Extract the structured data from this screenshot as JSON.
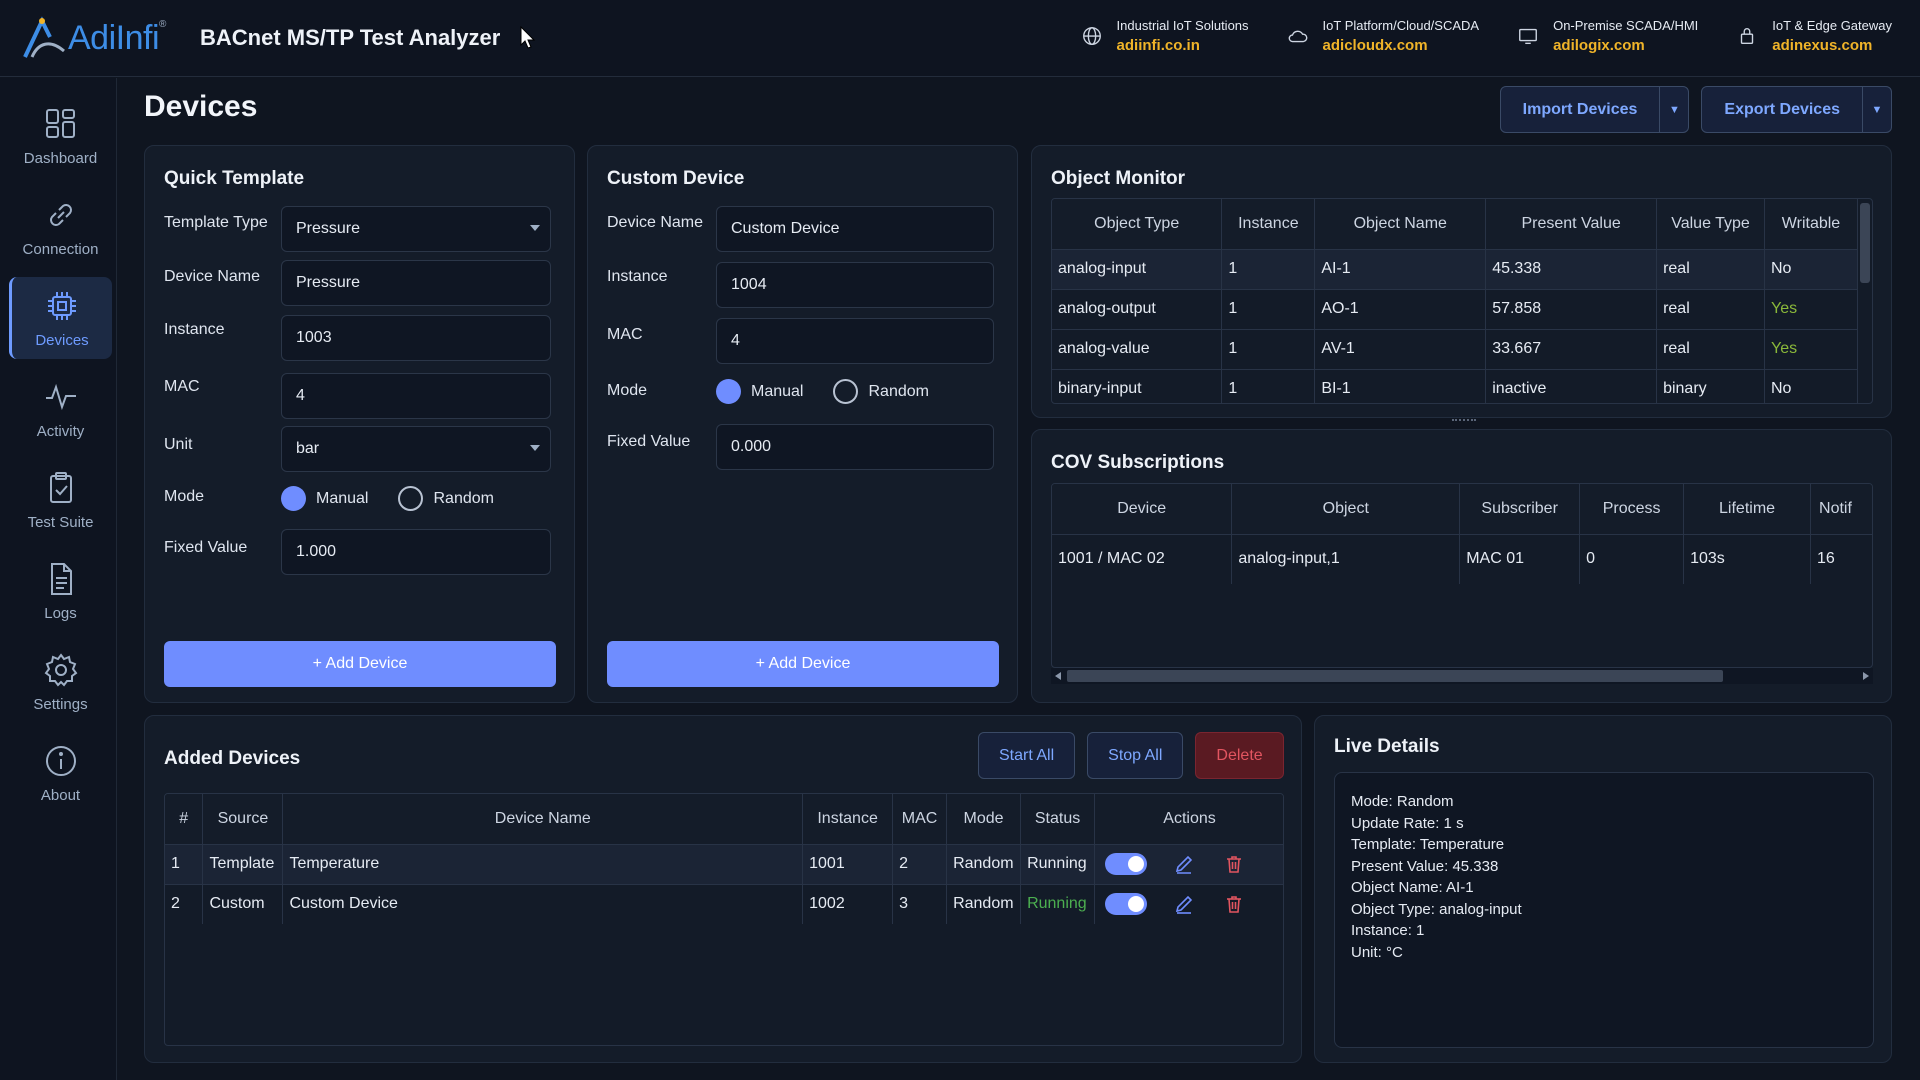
{
  "brand": {
    "logo_text": "AdiInfi",
    "logo_reg": "®",
    "app_title": "BACnet MS/TP Test Analyzer"
  },
  "links": [
    {
      "caption": "Industrial IoT Solutions",
      "url": "adiinfi.co.in",
      "icon": "globe-icon"
    },
    {
      "caption": "IoT Platform/Cloud/SCADA",
      "url": "adicloudx.com",
      "icon": "cloud-icon"
    },
    {
      "caption": "On-Premise SCADA/HMI",
      "url": "adilogix.com",
      "icon": "monitor-icon"
    },
    {
      "caption": "IoT & Edge Gateway",
      "url": "adinexus.com",
      "icon": "lock-icon"
    }
  ],
  "sidebar": {
    "items": [
      {
        "label": "Dashboard",
        "icon": "dashboard-icon"
      },
      {
        "label": "Connection",
        "icon": "link-icon"
      },
      {
        "label": "Devices",
        "icon": "chip-icon",
        "active": true
      },
      {
        "label": "Activity",
        "icon": "activity-icon"
      },
      {
        "label": "Test Suite",
        "icon": "clipboard-check-icon"
      },
      {
        "label": "Logs",
        "icon": "document-icon"
      },
      {
        "label": "Settings",
        "icon": "gear-icon"
      },
      {
        "label": "About",
        "icon": "info-icon"
      }
    ]
  },
  "page": {
    "title": "Devices",
    "import_label": "Import Devices",
    "export_label": "Export Devices"
  },
  "quick_template": {
    "title": "Quick Template",
    "template_type_label": "Template Type",
    "template_type_value": "Pressure",
    "device_name_label": "Device Name",
    "device_name_value": "Pressure",
    "instance_label": "Instance",
    "instance_value": "1003",
    "mac_label": "MAC",
    "mac_value": "4",
    "unit_label": "Unit",
    "unit_value": "bar",
    "mode_label": "Mode",
    "mode_manual": "Manual",
    "mode_random": "Random",
    "fixed_value_label": "Fixed Value",
    "fixed_value_value": "1.000",
    "add_label": "+ Add Device"
  },
  "custom_device": {
    "title": "Custom Device",
    "device_name_label": "Device Name",
    "device_name_value": "Custom Device",
    "instance_label": "Instance",
    "instance_value": "1004",
    "mac_label": "MAC",
    "mac_value": "4",
    "mode_label": "Mode",
    "mode_manual": "Manual",
    "mode_random": "Random",
    "fixed_value_label": "Fixed Value",
    "fixed_value_value": "0.000",
    "add_label": "+ Add Device"
  },
  "object_monitor": {
    "title": "Object Monitor",
    "columns": [
      "Object Type",
      "Instance",
      "Object Name",
      "Present Value",
      "Value Type",
      "Writable"
    ],
    "rows": [
      [
        "analog-input",
        "1",
        "AI-1",
        "45.338",
        "real",
        "No"
      ],
      [
        "analog-output",
        "1",
        "AO-1",
        "57.858",
        "real",
        "Yes"
      ],
      [
        "analog-value",
        "1",
        "AV-1",
        "33.667",
        "real",
        "Yes"
      ],
      [
        "binary-input",
        "1",
        "BI-1",
        "inactive",
        "binary",
        "No"
      ]
    ]
  },
  "cov": {
    "title": "COV Subscriptions",
    "columns": [
      "Device",
      "Object",
      "Subscriber",
      "Process",
      "Lifetime",
      "Notif"
    ],
    "rows": [
      [
        "1001 / MAC 02",
        "analog-input,1",
        "MAC 01",
        "0",
        "103s",
        "16"
      ]
    ]
  },
  "added_devices": {
    "title": "Added Devices",
    "start_all": "Start All",
    "stop_all": "Stop All",
    "delete": "Delete",
    "columns": [
      "#",
      "Source",
      "Device Name",
      "Instance",
      "MAC",
      "Mode",
      "Status",
      "Actions"
    ],
    "rows": [
      [
        "1",
        "Template",
        "Temperature",
        "1001",
        "2",
        "Random",
        "Running"
      ],
      [
        "2",
        "Custom",
        "Custom Device",
        "1002",
        "3",
        "Random",
        "Running"
      ]
    ]
  },
  "live_details": {
    "title": "Live Details",
    "lines": [
      "Mode: Random",
      "Update Rate: 1 s",
      "Template: Temperature",
      "Present Value: 45.338",
      "Object Name: AI-1",
      "Object Type: analog-input",
      "Instance: 1",
      "Unit: °C"
    ]
  },
  "colors": {
    "accent": "#6f8dff",
    "brand_blue": "#3d8de6",
    "link_gold": "#f0b429",
    "danger": "#e25560",
    "yes_green": "#8ab83a"
  }
}
